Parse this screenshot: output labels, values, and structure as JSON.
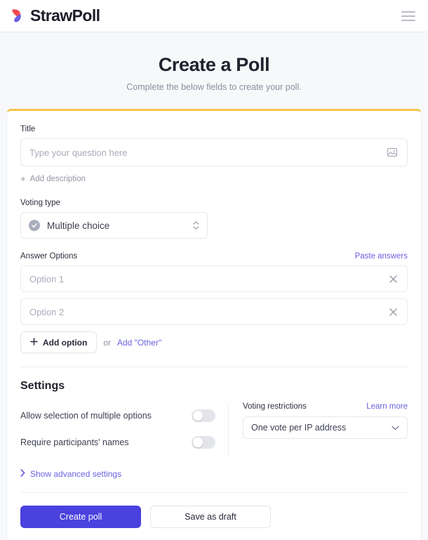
{
  "header": {
    "brand_name": "StrawPoll",
    "logo_color_primary": "#ef4a52",
    "logo_color_secondary": "#6b61e0",
    "menu_icon": "hamburger-icon"
  },
  "hero": {
    "title": "Create a Poll",
    "subtitle": "Complete the below fields to create your poll."
  },
  "theme": {
    "card_accent": "#f3c64b",
    "link_color": "#6b61e0",
    "primary_button": "#4a41df",
    "page_background": "#f7f8fa"
  },
  "form": {
    "title_field": {
      "label": "Title",
      "placeholder": "Type your question here",
      "value": "",
      "image_icon": "image-icon"
    },
    "add_description": {
      "label": "Add description",
      "icon": "plus-icon"
    },
    "voting_type": {
      "label": "Voting type",
      "selected": "Multiple choice",
      "icon": "check-circle-icon",
      "chevron": "chevron-updown-icon"
    },
    "answer_options": {
      "label": "Answer Options",
      "paste_link": "Paste answers",
      "options": [
        {
          "placeholder": "Option 1",
          "value": "",
          "remove_icon": "close-icon"
        },
        {
          "placeholder": "Option 2",
          "value": "",
          "remove_icon": "close-icon"
        }
      ],
      "add_option_label": "Add option",
      "add_option_icon": "plus-icon",
      "or_text": "or",
      "add_other_label": "Add \"Other\""
    }
  },
  "settings": {
    "heading": "Settings",
    "toggles": [
      {
        "label": "Allow selection of multiple options",
        "on": false
      },
      {
        "label": "Require participants' names",
        "on": false
      }
    ],
    "voting_restrictions": {
      "label": "Voting restrictions",
      "learn_more": "Learn more",
      "selected": "One vote per IP address",
      "chevron": "chevron-down-icon"
    },
    "advanced": {
      "label": "Show advanced settings",
      "icon": "chevron-right-icon"
    }
  },
  "actions": {
    "create_label": "Create poll",
    "draft_label": "Save as draft"
  }
}
